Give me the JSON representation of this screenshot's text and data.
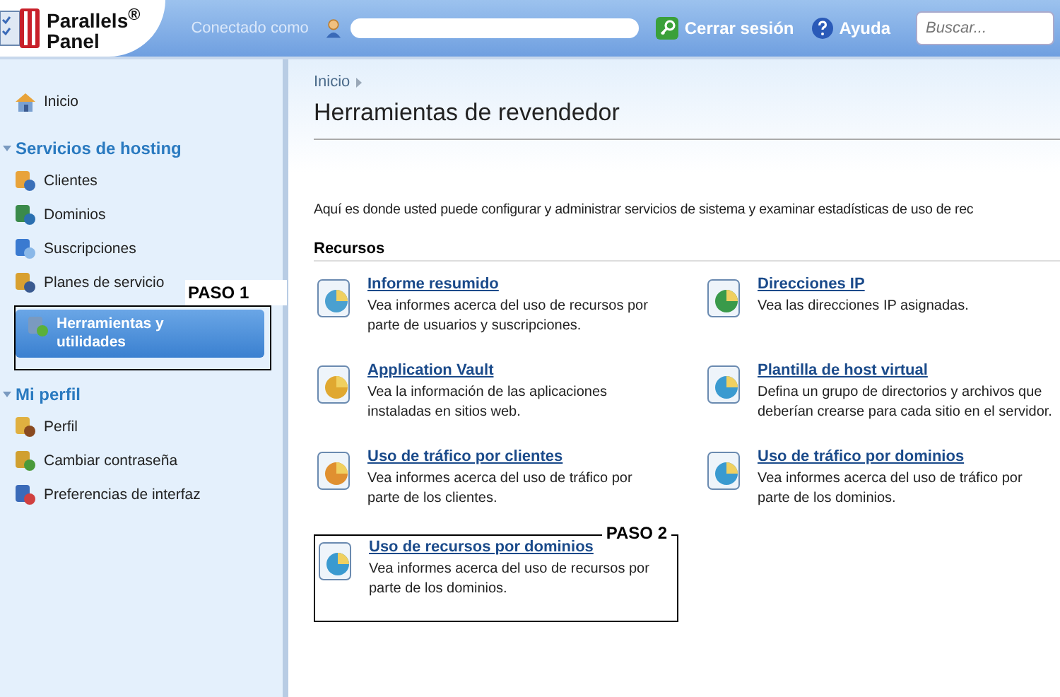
{
  "header": {
    "logo": {
      "line_1": "Parallels$^{®}$",
      "line_2": "Panel"
    },
    "connected_label": "Conectado como",
    "logout": "Cerrar sesión",
    "help": "Ayuda",
    "search": {
      "placeholder": "Buscar..."
    }
  },
  "sidebar": {
    "home": "Inicio",
    "sections": [
      {
        "title": "Servicios de hosting",
        "expanded": true,
        "items": [
          {
            "label": "Clientes",
            "selected": false
          },
          {
            "label": "Dominios",
            "selected": false
          },
          {
            "label": "Suscripciones",
            "selected": false
          },
          {
            "label": "Planes de servicio",
            "selected": false
          },
          {
            "label": "Herramientas y utilidades",
            "selected": true,
            "callout": "PASO 1"
          }
        ]
      },
      {
        "title": "Mi perfil",
        "expanded": true,
        "items": [
          {
            "label": "Perfil",
            "selected": false
          },
          {
            "label": "Cambiar contraseña",
            "selected": false
          },
          {
            "label": "Preferencias de interfaz",
            "selected": false
          }
        ]
      }
    ]
  },
  "main": {
    "breadcrumb": [
      "Inicio"
    ],
    "title": "Herramientas de revendedor",
    "description": "Aquí es donde usted puede configurar y administrar servicios de sistema y examinar estadísticas de uso de rec",
    "section": "Recursos",
    "resources": [
      {
        "title": "Informe resumido",
        "description": "Vea informes acerca del uso de recursos por parte de usuarios y suscripciones."
      },
      {
        "title": "Direcciones IP",
        "description": "Vea las direcciones IP asignadas."
      },
      {
        "title": "Application Vault",
        "description": "Vea la información de las aplicaciones instaladas en sitios web."
      },
      {
        "title": "Plantilla de host virtual",
        "description": "Defina un grupo de directorios y archivos que deberían crearse para cada sitio en el servidor."
      },
      {
        "title": "Uso de tráfico por clientes",
        "description": "Vea informes acerca del uso de tráfico por parte de los clientes."
      },
      {
        "title": "Uso de tráfico por dominios",
        "description": "Vea informes acerca del uso de tráfico por parte de los dominios."
      },
      {
        "title": "Uso de recursos por dominios",
        "description": "Vea informes acerca del uso de recursos por parte de los dominios.",
        "callout": "PASO 2"
      }
    ]
  }
}
